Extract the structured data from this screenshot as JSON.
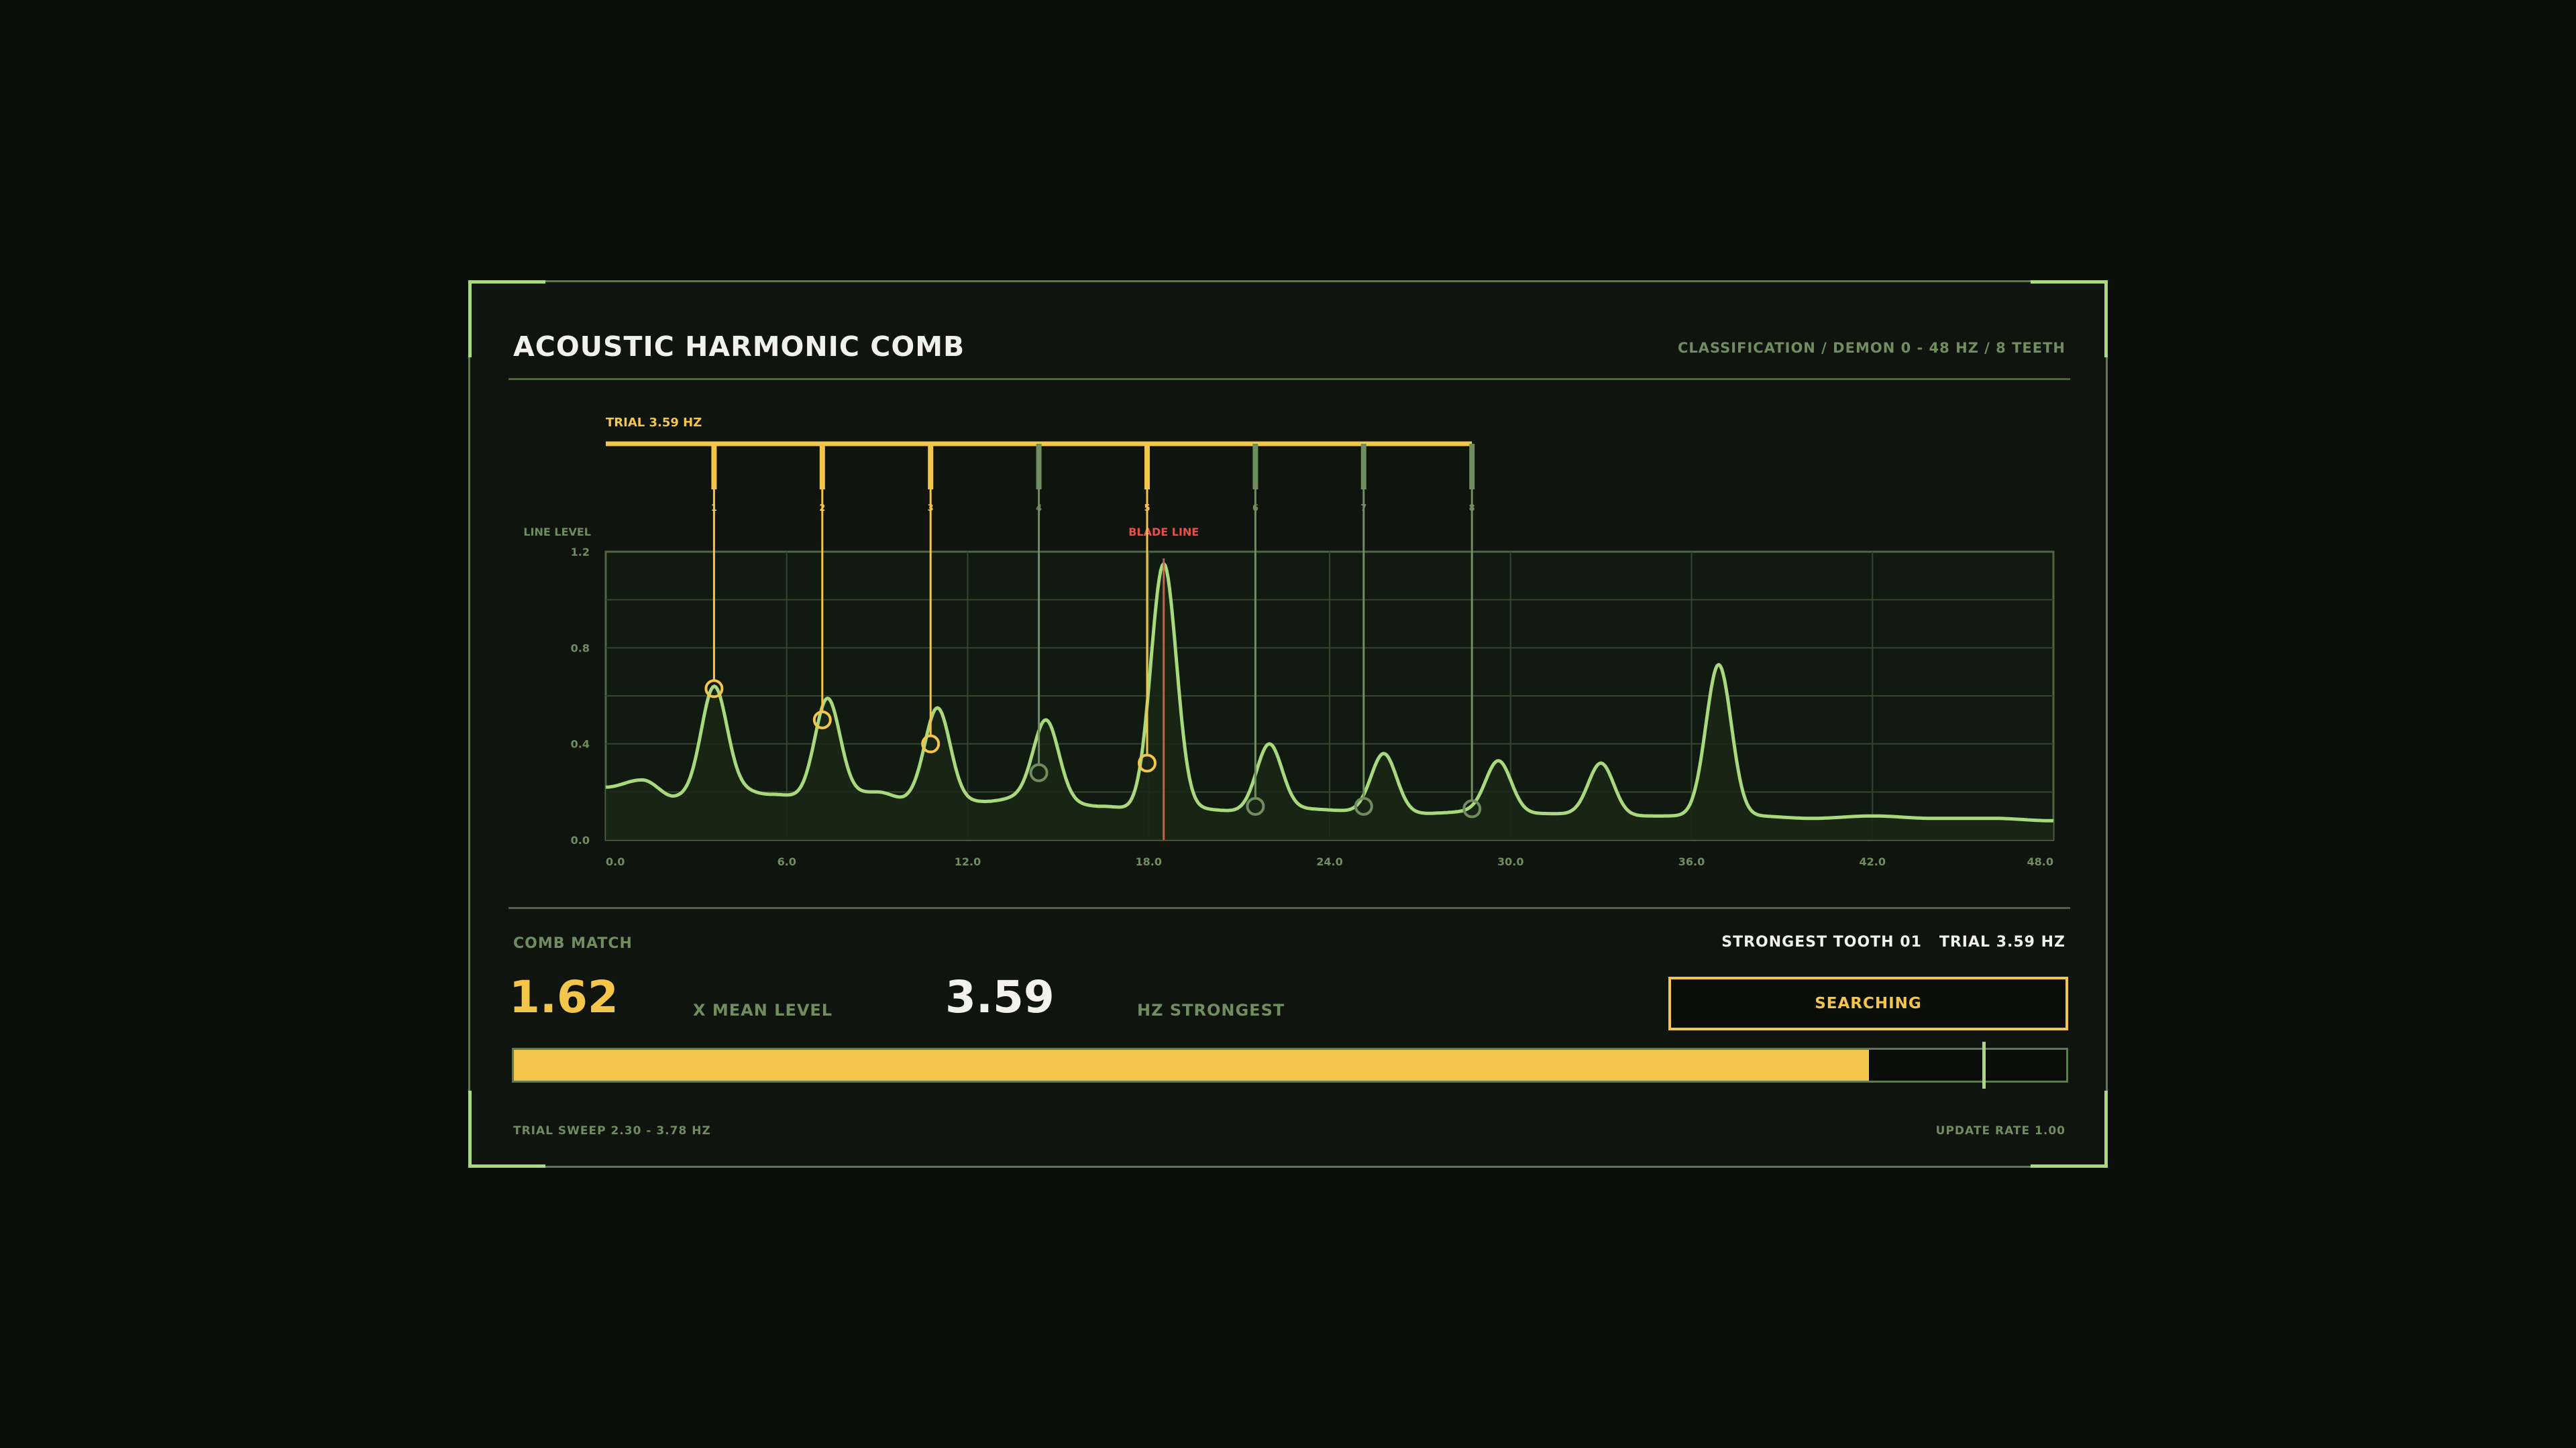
{
  "header": {
    "title": "ACOUSTIC HARMONIC COMB",
    "subtitle": "CLASSIFICATION / DEMON 0 - 48 HZ / 8 TEETH"
  },
  "colors": {
    "panel_border": "#5f7a4f",
    "corner_accent": "#a9d97c",
    "spectrum_line": "#a9d97c",
    "comb_active": "#f3c54a",
    "comb_inactive": "#6f8d5e",
    "blade_line": "#e0534a",
    "grid": "#34452d"
  },
  "chart_data": {
    "type": "line",
    "ylabel": "LINE LEVEL",
    "xlim": [
      0,
      48
    ],
    "ylim": [
      0,
      1.2
    ],
    "x_ticks": [
      "0.0",
      "6.0",
      "12.0",
      "18.0",
      "24.0",
      "30.0",
      "36.0",
      "42.0",
      "48.0"
    ],
    "y_ticks": [
      "0.0",
      "0.4",
      "0.8",
      "1.2"
    ],
    "grid": true,
    "baseline": [
      [
        0,
        0.22
      ],
      [
        1.2,
        0.25
      ],
      [
        2.3,
        0.18
      ],
      [
        4,
        0.22
      ],
      [
        5.5,
        0.19
      ],
      [
        7,
        0.17
      ],
      [
        9,
        0.2
      ],
      [
        10,
        0.17
      ],
      [
        12.5,
        0.16
      ],
      [
        14,
        0.18
      ],
      [
        16.5,
        0.14
      ],
      [
        17.5,
        0.13
      ],
      [
        19.5,
        0.13
      ],
      [
        21,
        0.12
      ],
      [
        23,
        0.13
      ],
      [
        25,
        0.12
      ],
      [
        27,
        0.11
      ],
      [
        29,
        0.12
      ],
      [
        31,
        0.11
      ],
      [
        34,
        0.1
      ],
      [
        36,
        0.1
      ],
      [
        38,
        0.1
      ],
      [
        40,
        0.09
      ],
      [
        42,
        0.1
      ],
      [
        44,
        0.09
      ],
      [
        46,
        0.09
      ],
      [
        48,
        0.08
      ]
    ],
    "peaks": [
      {
        "x": 3.59,
        "y": 0.64
      },
      {
        "x": 7.35,
        "y": 0.59
      },
      {
        "x": 11.0,
        "y": 0.55
      },
      {
        "x": 14.6,
        "y": 0.5
      },
      {
        "x": 18.5,
        "y": 1.15
      },
      {
        "x": 22.0,
        "y": 0.4
      },
      {
        "x": 25.8,
        "y": 0.36
      },
      {
        "x": 29.6,
        "y": 0.33
      },
      {
        "x": 33.0,
        "y": 0.32
      },
      {
        "x": 36.9,
        "y": 0.73
      }
    ],
    "blade_line": {
      "label": "BLADE LINE",
      "x": 18.5
    },
    "comb": {
      "label": "TRIAL 3.59 HZ",
      "fundamental_hz": 3.59,
      "teeth": [
        {
          "n": "1",
          "x": 3.59,
          "level": 0.63,
          "active": true
        },
        {
          "n": "2",
          "x": 7.18,
          "level": 0.5,
          "active": true
        },
        {
          "n": "3",
          "x": 10.77,
          "level": 0.4,
          "active": true
        },
        {
          "n": "4",
          "x": 14.36,
          "level": 0.28,
          "active": false
        },
        {
          "n": "5",
          "x": 17.95,
          "level": 0.32,
          "active": true
        },
        {
          "n": "6",
          "x": 21.54,
          "level": 0.14,
          "active": false
        },
        {
          "n": "7",
          "x": 25.13,
          "level": 0.14,
          "active": false
        },
        {
          "n": "8",
          "x": 28.72,
          "level": 0.13,
          "active": false
        }
      ]
    }
  },
  "match": {
    "label": "COMB MATCH",
    "strongest_text": "STRONGEST TOOTH 01   TRIAL 3.59 HZ",
    "mean_value": "1.62",
    "mean_unit": "X MEAN LEVEL",
    "hz_value": "3.59",
    "hz_unit": "HZ STRONGEST",
    "status": "SEARCHING",
    "meter_fill": 0.873,
    "meter_marker": 0.946
  },
  "footer": {
    "left": "TRIAL SWEEP 2.30 - 3.78 HZ",
    "right": "UPDATE RATE 1.00"
  }
}
